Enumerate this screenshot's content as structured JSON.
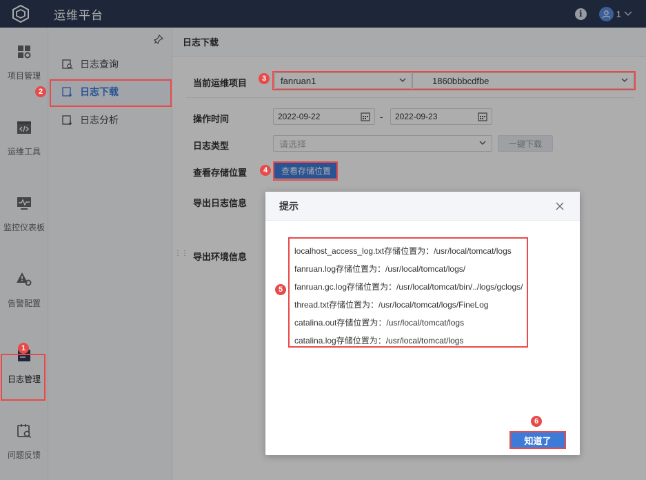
{
  "app": {
    "title": "运维平台",
    "user_name": "1"
  },
  "sidebar": {
    "items": [
      {
        "label": "项目管理",
        "icon": "grid-icon"
      },
      {
        "label": "运维工具",
        "icon": "code-icon"
      },
      {
        "label": "监控仪表板",
        "icon": "monitor-icon"
      },
      {
        "label": "告警配置",
        "icon": "alert-gear-icon"
      },
      {
        "label": "日志管理",
        "icon": "log-icon"
      },
      {
        "label": "问题反馈",
        "icon": "feedback-icon"
      }
    ]
  },
  "submenu": {
    "items": [
      {
        "label": "日志查询"
      },
      {
        "label": "日志下载"
      },
      {
        "label": "日志分析"
      }
    ]
  },
  "main": {
    "title": "日志下载",
    "form": {
      "project_label": "当前运维项目",
      "project_value": "fanruan1",
      "node_value": "1860bbbcdfbe",
      "time_label": "操作时间",
      "start_date": "2022-09-22",
      "date_separator": "-",
      "end_date": "2022-09-23",
      "type_label": "日志类型",
      "type_placeholder": "请选择",
      "one_click_download": "一键下载",
      "storage_label": "查看存储位置",
      "storage_button": "查看存储位置",
      "export_log_label": "导出日志信息",
      "export_env_label": "导出环境信息"
    }
  },
  "modal": {
    "title": "提示",
    "lines": [
      "localhost_access_log.txt存储位置为：/usr/local/tomcat/logs",
      "fanruan.log存储位置为：/usr/local/tomcat/logs/",
      "fanruan.gc.log存储位置为：/usr/local/tomcat/bin/../logs/gclogs/",
      "thread.txt存储位置为：/usr/local/tomcat/logs/FineLog",
      "catalina.out存储位置为：/usr/local/tomcat/logs",
      "catalina.log存储位置为：/usr/local/tomcat/logs"
    ],
    "ok_label": "知道了"
  },
  "annotations": [
    "1",
    "2",
    "3",
    "4",
    "5",
    "6"
  ],
  "colors": {
    "topbar": "#2b3a55",
    "primary": "#3d7bd9",
    "annotation": "#e84a4a"
  }
}
